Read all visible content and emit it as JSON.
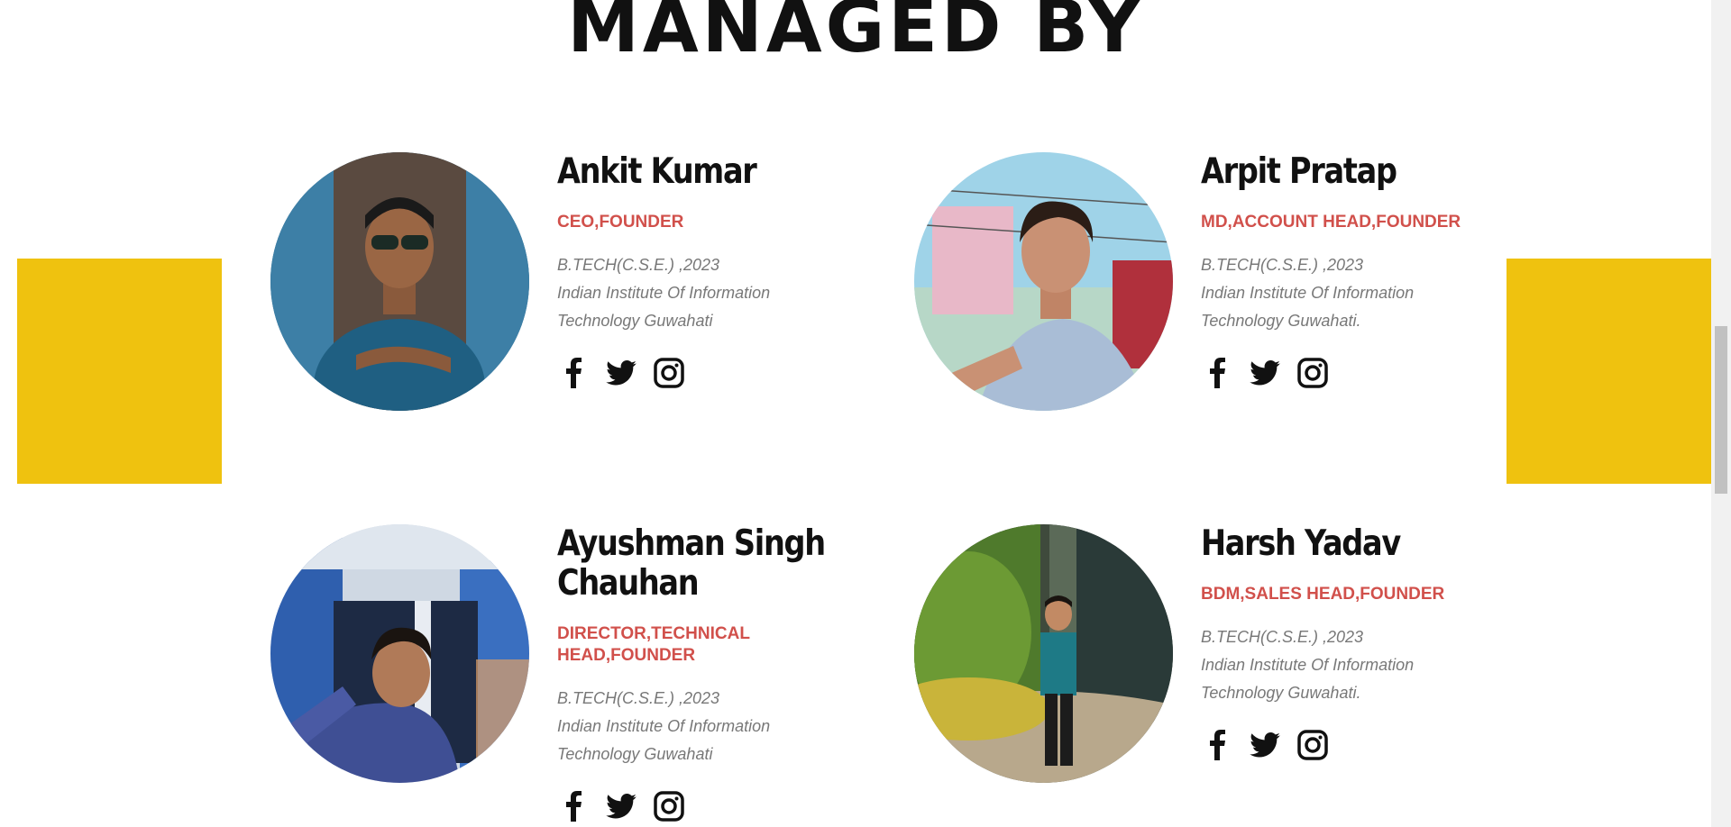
{
  "section": {
    "title": "MANAGED BY"
  },
  "colors": {
    "accent_yellow": "#efc20f",
    "role_red": "#d1504b",
    "text_dark": "#111111",
    "text_muted": "#787878"
  },
  "members": [
    {
      "name": "Ankit Kumar",
      "role": "CEO,FOUNDER",
      "degree": "B.TECH(C.S.E.) ,2023",
      "institute_line1": "Indian Institute Of Information",
      "institute_line2": "Technology Guwahati",
      "socials": [
        "facebook-icon",
        "twitter-icon",
        "instagram-icon"
      ]
    },
    {
      "name": "Arpit Pratap",
      "role": "MD,ACCOUNT HEAD,FOUNDER",
      "degree": "B.TECH(C.S.E.) ,2023",
      "institute_line1": "Indian Institute Of Information",
      "institute_line2": "Technology Guwahati.",
      "socials": [
        "facebook-icon",
        "twitter-icon",
        "instagram-icon"
      ]
    },
    {
      "name": "Ayushman Singh Chauhan",
      "role": "DIRECTOR,TECHNICAL HEAD,FOUNDER",
      "degree": "B.TECH(C.S.E.) ,2023",
      "institute_line1": "Indian Institute Of Information",
      "institute_line2": "Technology Guwahati",
      "socials": [
        "facebook-icon",
        "twitter-icon",
        "instagram-icon"
      ]
    },
    {
      "name": "Harsh Yadav",
      "role": "BDM,SALES HEAD,FOUNDER",
      "degree": "B.TECH(C.S.E.) ,2023",
      "institute_line1": "Indian Institute Of Information",
      "institute_line2": "Technology Guwahati.",
      "socials": [
        "facebook-icon",
        "twitter-icon",
        "instagram-icon"
      ]
    }
  ]
}
